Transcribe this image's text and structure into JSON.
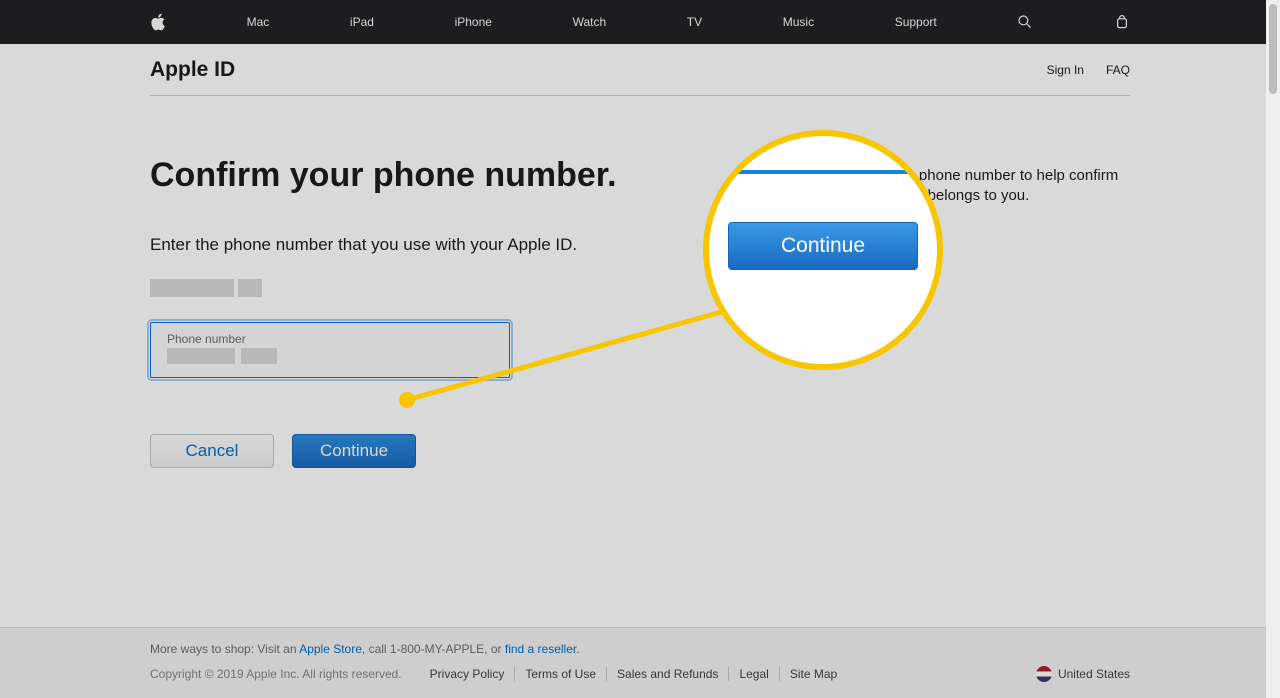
{
  "nav": {
    "items": [
      "Mac",
      "iPad",
      "iPhone",
      "Watch",
      "TV",
      "Music",
      "Support"
    ]
  },
  "localHeader": {
    "title": "Apple ID",
    "signIn": "Sign In",
    "faq": "FAQ"
  },
  "main": {
    "title": "Confirm your phone number.",
    "instruction": "Enter the phone number that you use with your Apple ID.",
    "phoneLabel": "Phone number",
    "cancel": "Cancel",
    "continue": "Continue",
    "sideInfo": "We ask for your phone number to help confirm that this Apple ID belongs to you."
  },
  "callout": {
    "button": "Continue"
  },
  "footer": {
    "moreWays_pre": "More ways to shop: Visit an ",
    "appleStore": "Apple Store",
    "moreWays_mid": ", call 1-800-MY-APPLE, or ",
    "findReseller": "find a reseller",
    "moreWays_post": ".",
    "copyright": "Copyright © 2019 Apple Inc. All rights reserved.",
    "links": [
      "Privacy Policy",
      "Terms of Use",
      "Sales and Refunds",
      "Legal",
      "Site Map"
    ],
    "locale": "United States"
  }
}
